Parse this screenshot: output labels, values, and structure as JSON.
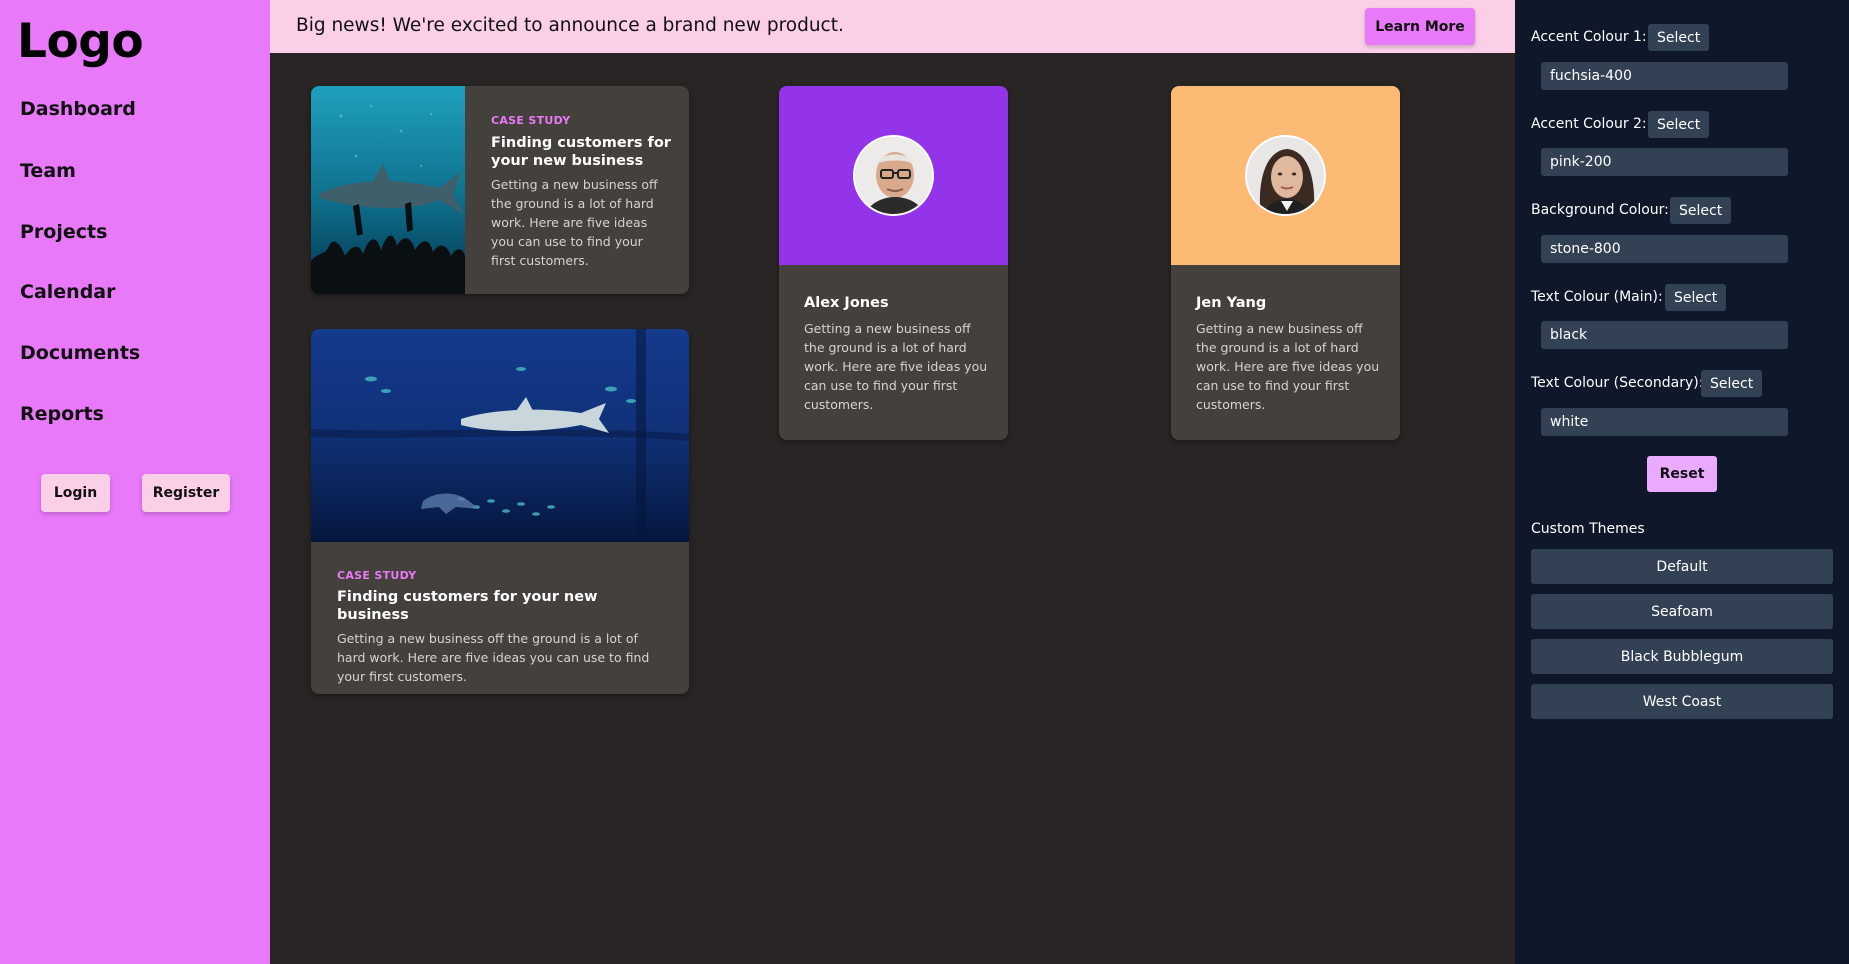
{
  "sidebar": {
    "logo": "Logo",
    "nav": [
      "Dashboard",
      "Team",
      "Projects",
      "Calendar",
      "Documents",
      "Reports"
    ],
    "login_label": "Login",
    "register_label": "Register"
  },
  "banner": {
    "text": "Big news! We're excited to announce a brand new product.",
    "button_label": "Learn More"
  },
  "cards": {
    "case1": {
      "eyebrow": "CASE STUDY",
      "title": "Finding customers for your new business",
      "body": "Getting a new business off the ground is a lot of hard work. Here are five ideas you can use to find your first customers."
    },
    "case2": {
      "eyebrow": "CASE STUDY",
      "title": "Finding customers for your new business",
      "body": "Getting a new business off the ground is a lot of hard work. Here are five ideas you can use to find your first customers."
    },
    "profile1": {
      "name": "Alex Jones",
      "body": "Getting a new business off the ground is a lot of hard work. Here are five ideas you can use to find your first customers."
    },
    "profile2": {
      "name": "Jen Yang",
      "body": "Getting a new business off the ground is a lot of hard work. Here are five ideas you can use to find your first customers."
    }
  },
  "panel": {
    "select_label": "Select",
    "accent1": {
      "label": "Accent Colour 1:",
      "value": "fuchsia-400"
    },
    "accent2": {
      "label": "Accent Colour 2:",
      "value": "pink-200"
    },
    "background": {
      "label": "Background Colour:",
      "value": "stone-800"
    },
    "text_main": {
      "label": "Text Colour (Main):",
      "value": "black"
    },
    "text_secondary": {
      "label": "Text Colour (Secondary):",
      "value": "white"
    },
    "reset_label": "Reset",
    "themes_heading": "Custom Themes",
    "themes": [
      "Default",
      "Seafoam",
      "Black Bubblegum",
      "West Coast"
    ]
  },
  "colors": {
    "accent1": "#e879f9",
    "accent2": "#fbcfe8",
    "background": "#292524",
    "card": "#44403c",
    "panel": "#0f172a",
    "panel_control": "#334155",
    "profile1_header": "#9333ea",
    "profile2_header": "#fdba74"
  }
}
